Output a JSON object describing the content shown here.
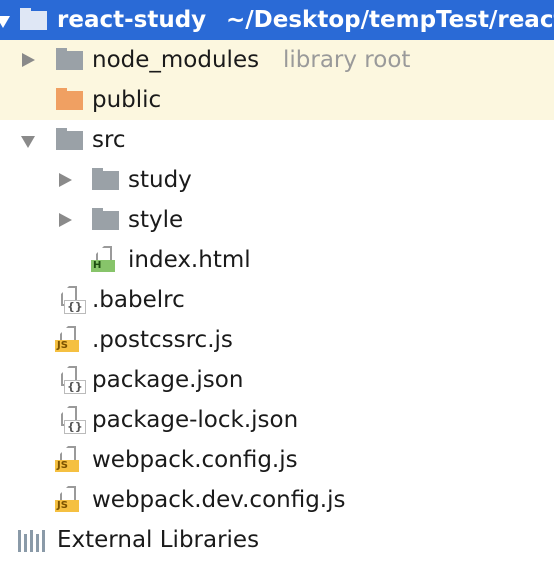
{
  "project": {
    "name": "react-study",
    "path": "~/Desktop/tempTest/react-"
  },
  "nodes": [
    {
      "label": "node_modules",
      "hint": "library root",
      "icon": "folder-icon",
      "expanded": false
    },
    {
      "label": "public",
      "icon": "folder-orange-icon"
    },
    {
      "label": "src",
      "icon": "folder-icon",
      "expanded": true
    },
    {
      "label": "study",
      "icon": "folder-icon",
      "expanded": false
    },
    {
      "label": "style",
      "icon": "folder-icon",
      "expanded": false
    },
    {
      "label": "index.html",
      "icon": "html-file-icon",
      "badge": "H"
    },
    {
      "label": ".babelrc",
      "icon": "json-file-icon",
      "badge": "{}"
    },
    {
      "label": ".postcssrc.js",
      "icon": "js-file-icon",
      "badge": "JS"
    },
    {
      "label": "package.json",
      "icon": "json-file-icon",
      "badge": "{}"
    },
    {
      "label": "package-lock.json",
      "icon": "json-file-icon",
      "badge": "{}"
    },
    {
      "label": "webpack.config.js",
      "icon": "js-file-icon",
      "badge": "JS"
    },
    {
      "label": "webpack.dev.config.js",
      "icon": "js-file-icon",
      "badge": "JS"
    }
  ],
  "external": {
    "label": "External Libraries",
    "icon": "library-icon"
  },
  "colors": {
    "selection": "#2a6ad6",
    "library_row": "#fcf7df",
    "folder": "#9aa1a7",
    "resource_folder": "#f0a062"
  }
}
